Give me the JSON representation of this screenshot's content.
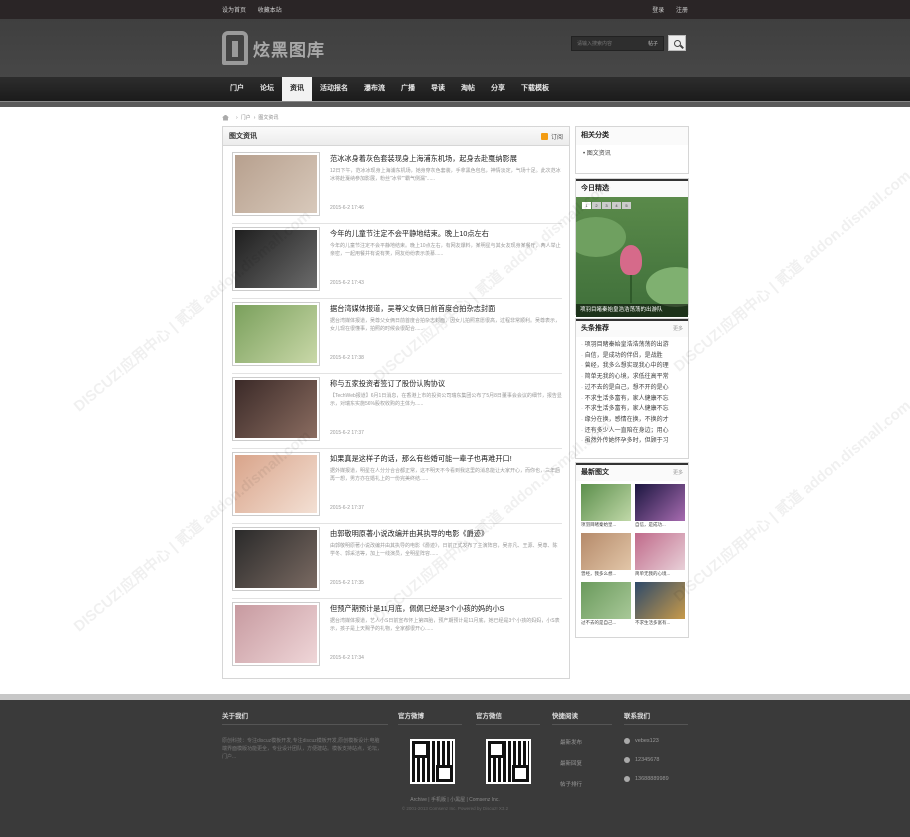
{
  "topbar": {
    "left_links": [
      "设为首页",
      "收藏本站"
    ],
    "right_links": [
      "登录",
      "注册"
    ]
  },
  "header": {
    "logo_text": "炫黑图库",
    "search_placeholder": "请输入搜索内容",
    "search_type": "帖子"
  },
  "nav": [
    "门户",
    "论坛",
    "资讯",
    "活动报名",
    "瀑布流",
    "广播",
    "导读",
    "淘帖",
    "分享",
    "下载模板"
  ],
  "breadcrumb": [
    "门户",
    "图文资讯"
  ],
  "main": {
    "title": "图文资讯",
    "rss_label": "订阅",
    "articles": [
      {
        "title": "范冰冰身着灰色套装现身上海浦东机场，起身去赴戛纳影展",
        "summary": "12日下午，范冰冰现身上海浦东机场，她身穿灰色套装，手拿黑色包包，神情淡定，气场十足。此次范冰冰将赴戛纳参加影展，粉丝“冰爷”“霸气侧漏”......",
        "date": "2015-6-2 17:46",
        "colors": [
          "#b7a08e",
          "#d8c9bb"
        ]
      },
      {
        "title": "今年的儿童节注定不会平静地结束。晚上10点左右",
        "summary": "今年的儿童节注定不会平静地结束。晚上10点左右，有网友爆料，某明星与其女友现身某餐厅，两人举止亲密，一起用餐并有说有笑，网友纷纷表示羡慕......",
        "date": "2015-6-2 17:43",
        "colors": [
          "#1f1f1f",
          "#6b6b6b"
        ]
      },
      {
        "title": "据台湾媒体报道，吴尊父女俩日前首度合拍杂志封面",
        "summary": "据台湾媒体报道，吴尊父女俩日前首度合拍杂志封面，因女儿拍照意愿很高，过程非常顺利。吴尊表示，女儿现在很懂事，拍照的时候会很配合......",
        "date": "2015-6-2 17:38",
        "colors": [
          "#7aa05c",
          "#c9d8a8"
        ]
      },
      {
        "title": "称与五家投资者签订了股份认购协议",
        "summary": "【TechWeb报道】6月1日消息，在香港上市的投资公司瑞东集团公布了5月8日董事会会议的细节，报告显示，对瑞东实施56%股权收购的主体为......",
        "date": "2015-6-2 17:37",
        "colors": [
          "#3b2a28",
          "#8a6c60"
        ]
      },
      {
        "title": "如果真是这样子的话，那么有些婚可能一辈子也再难开口!",
        "summary": "据外媒报道，明星在人分分合合都正常，这不明天不今看到我这里的消息能让大家开心，而你也，三年后再一想，男方亦在婚礼上的一份完美终结......",
        "date": "2015-6-2 17:37",
        "colors": [
          "#d9a48a",
          "#f3e0d4"
        ]
      },
      {
        "title": "由郭敬明原著小说改编并由其执导的电影《爵迹》",
        "summary": "由郭敬明原著小说改编并由其执导的电影《爵迹》，日前正式发布了主演阵容，吴亦凡、王源、吴尊、陈学冬、郭采洁等，加上一线演员，全明星阵容......",
        "date": "2015-6-2 17:35",
        "colors": [
          "#2a2a2a",
          "#7a6a62"
        ]
      },
      {
        "title": "但预产期预计是11月底，佩佩已经是3个小孩的妈的小S",
        "summary": "据台湾媒体报道，艺人小S日前宣布怀上第四胎，预产期预计是11月底，她已经是3个小孩的妈妈，小S表示，孩子是上天赐予的礼物，全家都很开心......",
        "date": "2015-6-2 17:34",
        "colors": [
          "#c79aa0",
          "#efd6d8"
        ]
      }
    ]
  },
  "sidebar": {
    "category": {
      "title": "相关分类",
      "items": [
        "图文资讯"
      ]
    },
    "today": {
      "title": "今日精选",
      "dots": [
        "1",
        "2",
        "3",
        "4",
        "5"
      ],
      "caption": "项羽目睹秦始皇浩浩荡荡的出游队"
    },
    "headlines": {
      "title": "头条推荐",
      "more": "更多",
      "items": [
        "项羽目睹秦始皇浩浩荡荡的出游",
        "自信，是成功的伴侣，是战胜",
        "曾经，我多么想实现我心中的理",
        "简单无我的心境，求低往高平常",
        "过不去的是自己，想不开的是心",
        "不求生活多富有，家人健康不忘",
        "不求生活多富有，家人健康不忘",
        "缘分在换，感情在换，不换的才",
        "还有多少人一直陪在身边；用心",
        "虽然外传她怀孕多时，但顾于习"
      ]
    },
    "latest": {
      "title": "最新图文",
      "more": "更多",
      "items": [
        {
          "caption": "项羽目睹秦始皇...",
          "colors": [
            "#5c8f4c",
            "#c0d8a8"
          ]
        },
        {
          "caption": "自信，是成功...",
          "colors": [
            "#1b1640",
            "#a76bb0"
          ]
        },
        {
          "caption": "曾经，我多么想...",
          "colors": [
            "#b58a6a",
            "#e2c6a8"
          ]
        },
        {
          "caption": "简单无我的心境...",
          "colors": [
            "#c06a8a",
            "#e8d0d8"
          ]
        },
        {
          "caption": "过不去的是自己...",
          "colors": [
            "#6a9a5c",
            "#a8c898"
          ]
        },
        {
          "caption": "不求生活多富有...",
          "colors": [
            "#2e4a6a",
            "#c89a4a"
          ]
        }
      ]
    }
  },
  "footer": {
    "about": {
      "title": "关于我们",
      "text": "原创科技：专注discuz模板开发,专注discuz模板开发,原创模板设计:电脑端界面模版功能更全，专业设计团队，方便建站。模板支持站点，论坛，门户..."
    },
    "weibo": {
      "title": "官方微博"
    },
    "weixin": {
      "title": "官方微信"
    },
    "quick": {
      "title": "快捷阅读",
      "items": [
        "最新发布",
        "最新回复",
        "帖子排行"
      ]
    },
    "contact": {
      "title": "联系我们",
      "items": [
        "vebes123",
        "12345678",
        "13688889989"
      ]
    },
    "links": "Archive | 手机版 | 小黑屋 | Comsenz Inc.",
    "copyright": "© 2001-2013 Comsenz Inc. Powered by Discuz! X3.2"
  },
  "watermark": "DISCUZ!应用中心 | 贰道 addon.dismall.com"
}
